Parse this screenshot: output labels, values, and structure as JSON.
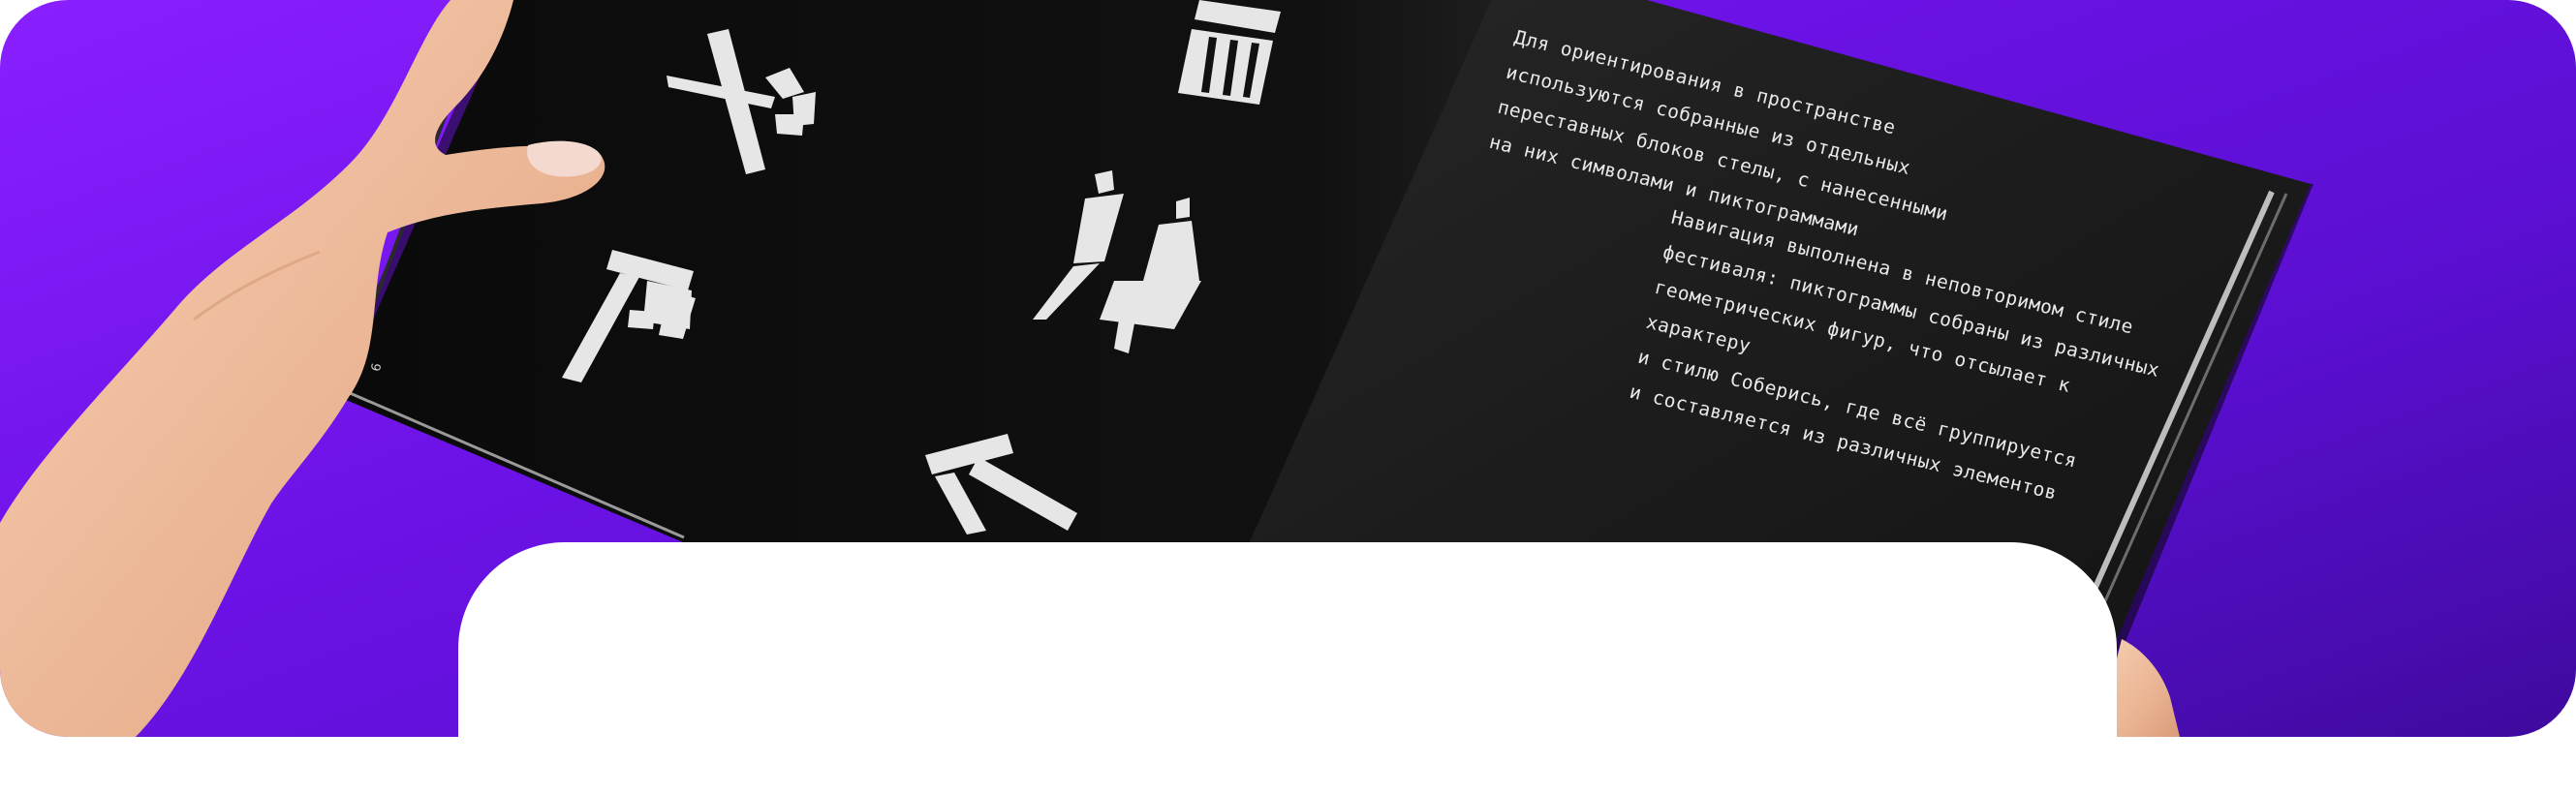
{
  "scene": {
    "description_colors": {
      "background": "#6b12e6",
      "book_left_page": "#0d0d0d",
      "book_right_page": "#1a1a1a",
      "text": "#e9e9e9",
      "skin": "#f2c3a2"
    },
    "page_number": "6",
    "right_page": {
      "paragraph_1": "Для ориентирования в пространстве\nиспользуются собранные из отдельных\nпереставных блоков стелы, с нанесенными\nна них символами и пиктограммами",
      "paragraph_2": "Навигация выполнена в неповторимом стиле\nфестиваля: пиктограммы собраны из различных\nгеометрических фигур, что отсылает к характеру\nи стилю Соберись, где всё группируется\nи составляется из различных элементов"
    },
    "pictograms": [
      "no-smoking-icon",
      "trash-bin-icon",
      "restroom-icon",
      "table-icon",
      "arrow-icon"
    ]
  }
}
